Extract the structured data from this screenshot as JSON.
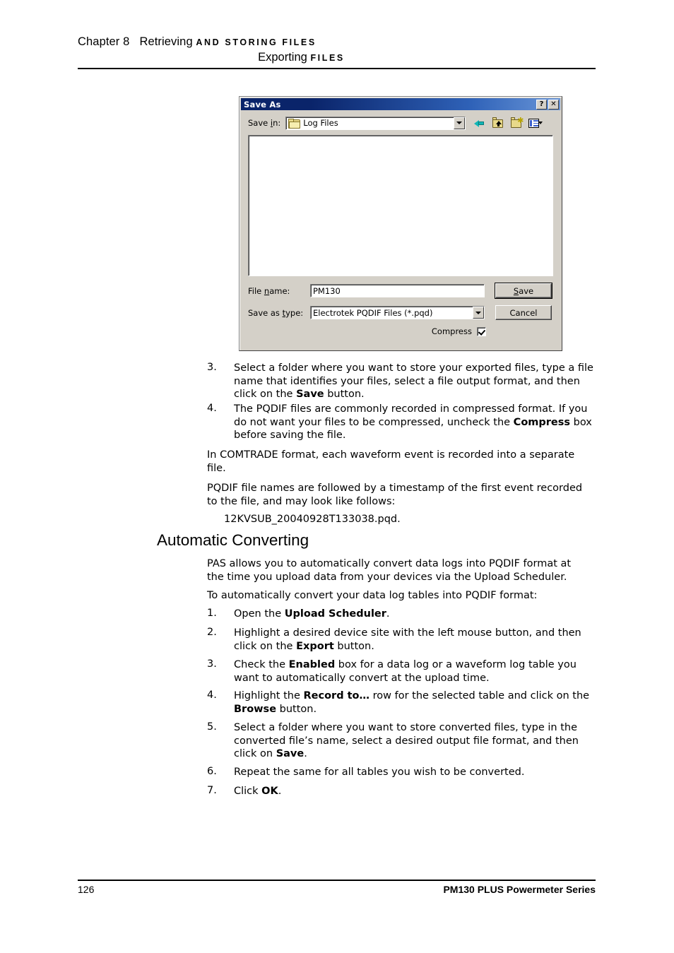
{
  "header": {
    "chapter": "Chapter 8",
    "chapter_title_normal": "Retrieving",
    "chapter_title_caps": "AND STORING FILES",
    "section_normal": "Exporting",
    "section_caps": "FILES"
  },
  "dialog": {
    "title": "Save As",
    "help_button": "?",
    "close_button": "✕",
    "save_in_label": "Save in:",
    "save_in_value": "Log Files",
    "toolbar": [
      {
        "name": "back-icon",
        "tooltip": "Back"
      },
      {
        "name": "up-one-level-icon",
        "tooltip": "Up One Level"
      },
      {
        "name": "new-folder-icon",
        "tooltip": "Create New Folder"
      },
      {
        "name": "views-icon",
        "tooltip": "Views"
      }
    ],
    "file_name_label": "File name:",
    "file_name_value": "PM130",
    "save_as_type_label": "Save as type:",
    "save_as_type_value": "Electrotek PQDIF Files (*.pqd)",
    "save_button": "Save",
    "cancel_button": "Cancel",
    "compress_label": "Compress",
    "compress_checked": true,
    "file_list_items": []
  },
  "steps_export": [
    {
      "num": "3.",
      "parts": [
        {
          "t": "Select a folder where you want to store your exported files, type a file name that identifies your files, select a file output format, and then click on the ",
          "b": false
        },
        {
          "t": "Save",
          "b": true
        },
        {
          "t": " button.",
          "b": false
        }
      ]
    },
    {
      "num": "4.",
      "parts": [
        {
          "t": "The PQDIF files are commonly recorded in compressed format. If you do not want your files to be compressed, uncheck the ",
          "b": false
        },
        {
          "t": "Compress",
          "b": true
        },
        {
          "t": " box before saving the file.",
          "b": false
        }
      ]
    }
  ],
  "paragraphs": {
    "comtrade": "In COMTRADE format, each waveform event is recorded into a separate file.",
    "pqdif_names": "PQDIF file names are followed by a timestamp of the first event recorded to the file, and may look like follows:",
    "filename_example": "12KVSUB_20040928T133038.pqd.",
    "pas_intro": "PAS allows you to automatically convert data logs into PQDIF format at the time you upload data from your devices via the Upload Scheduler.",
    "to_convert": "To automatically convert your data log tables into PQDIF format:"
  },
  "section_heading": "Automatic Converting",
  "steps_auto": [
    {
      "num": "1.",
      "parts": [
        {
          "t": "Open the ",
          "b": false
        },
        {
          "t": "Upload Scheduler",
          "b": true
        },
        {
          "t": ".",
          "b": false
        }
      ]
    },
    {
      "num": "2.",
      "parts": [
        {
          "t": "Highlight a desired device site with the left mouse button, and then click on the ",
          "b": false
        },
        {
          "t": "Export",
          "b": true
        },
        {
          "t": " button.",
          "b": false
        }
      ]
    },
    {
      "num": "3.",
      "parts": [
        {
          "t": "Check the ",
          "b": false
        },
        {
          "t": "Enabled",
          "b": true
        },
        {
          "t": " box for a data log or a waveform log table you want to automatically convert at the upload time.",
          "b": false
        }
      ]
    },
    {
      "num": "4.",
      "parts": [
        {
          "t": "Highlight the ",
          "b": false
        },
        {
          "t": "Record to…",
          "b": true
        },
        {
          "t": " row for the selected table and click on the ",
          "b": false
        },
        {
          "t": "Browse",
          "b": true
        },
        {
          "t": " button.",
          "b": false
        }
      ]
    },
    {
      "num": "5.",
      "parts": [
        {
          "t": "Select a folder where you want to store converted files, type in the converted file’s name, select a desired output file format, and then click on ",
          "b": false
        },
        {
          "t": "Save",
          "b": true
        },
        {
          "t": ".",
          "b": false
        }
      ]
    },
    {
      "num": "6.",
      "parts": [
        {
          "t": "Repeat the same for all tables you wish to be converted.",
          "b": false
        }
      ]
    },
    {
      "num": "7.",
      "parts": [
        {
          "t": "Click ",
          "b": false
        },
        {
          "t": "OK",
          "b": true
        },
        {
          "t": ".",
          "b": false
        }
      ]
    }
  ],
  "footer": {
    "page_number": "126",
    "product": "PM130 PLUS Powermeter Series"
  },
  "colors": {
    "titlebar_start": "#0a246a",
    "titlebar_end": "#6a96d8",
    "dialog_face": "#d4d0c8",
    "folder_yellow": "#e8d98a",
    "back_arrow_teal": "#11b6b6",
    "text": "#000000",
    "page_background": "#ffffff"
  }
}
